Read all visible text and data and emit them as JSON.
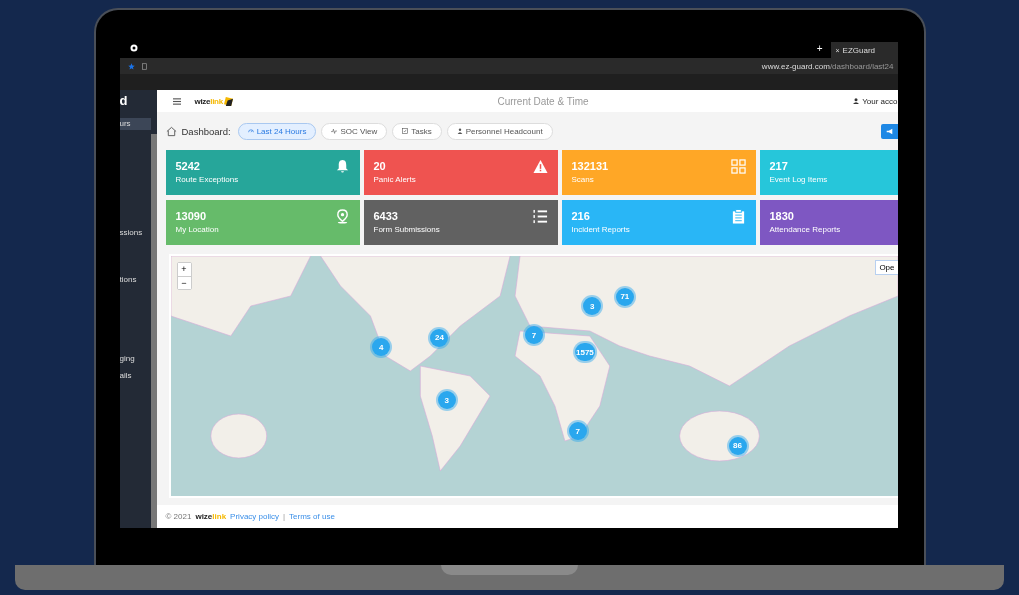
{
  "browser": {
    "tab_close": "×",
    "tab_title": "EZGuard",
    "new_tab": "+",
    "url_host": "www.ez-guard.com",
    "url_path": "/dashboard/last24"
  },
  "sidebar": {
    "logo": "d",
    "items": [
      {
        "label": "urs",
        "selected": true
      },
      {
        "label": "ssions",
        "selected": false
      },
      {
        "label": "tions",
        "selected": false
      },
      {
        "label": "ging",
        "selected": false
      },
      {
        "label": "ails",
        "selected": false
      }
    ]
  },
  "header": {
    "logo_a": "wize",
    "logo_b": "link",
    "title": "Current Date & Time",
    "account": "Your acco"
  },
  "toolbar": {
    "title": "Dashboard:",
    "tabs": [
      {
        "label": "Last 24 Hours",
        "selected": true
      },
      {
        "label": "SOC View",
        "selected": false
      },
      {
        "label": "Tasks",
        "selected": false
      },
      {
        "label": "Personnel Headcount",
        "selected": false
      }
    ]
  },
  "cards": [
    {
      "value": "5242",
      "label": "Route Exceptions",
      "color": "#26a69a"
    },
    {
      "value": "20",
      "label": "Panic Alerts",
      "color": "#ef5350"
    },
    {
      "value": "132131",
      "label": "Scans",
      "color": "#ffa726"
    },
    {
      "value": "217",
      "label": "Event Log Items",
      "color": "#26c6da"
    },
    {
      "value": "13090",
      "label": "My Location",
      "color": "#66bb6a"
    },
    {
      "value": "6433",
      "label": "Form Submissions",
      "color": "#616161"
    },
    {
      "value": "216",
      "label": "Incident Reports",
      "color": "#29b6f6"
    },
    {
      "value": "1830",
      "label": "Attendance Reports",
      "color": "#7e57c2"
    }
  ],
  "map": {
    "zoom_in": "+",
    "zoom_out": "−",
    "open_button": "Ope",
    "clusters": [
      "4",
      "24",
      "7",
      "3",
      "71",
      "1575",
      "3",
      "7",
      "86"
    ]
  },
  "footer": {
    "copyright": "© 2021",
    "logo_a": "wize",
    "logo_b": "link",
    "privacy": "Privacy policy",
    "separator": "|",
    "terms": "Terms of use"
  }
}
